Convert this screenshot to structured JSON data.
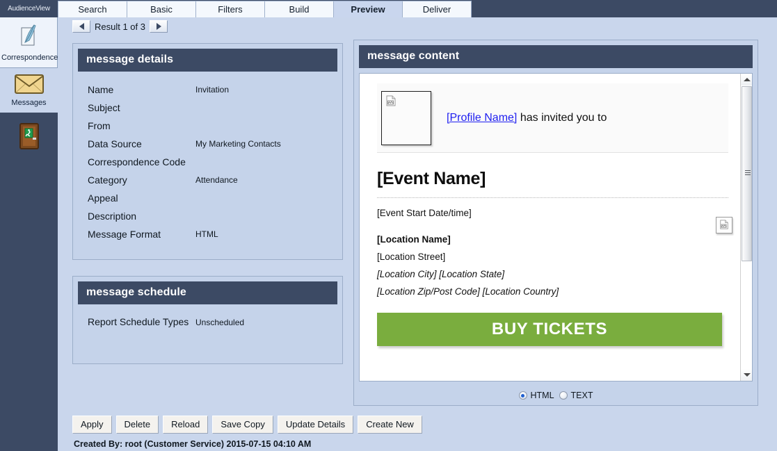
{
  "brand": {
    "name": "AudienceView"
  },
  "tabs": [
    {
      "label": "Search",
      "active": false
    },
    {
      "label": "Basic",
      "active": false
    },
    {
      "label": "Filters",
      "active": false
    },
    {
      "label": "Build",
      "active": false
    },
    {
      "label": "Preview",
      "active": true
    },
    {
      "label": "Deliver",
      "active": false
    }
  ],
  "sidebar": {
    "items": [
      {
        "label": "Correspondence",
        "icon": "quill-icon",
        "selected": true
      },
      {
        "label": "Messages",
        "icon": "envelope-icon",
        "selected": false
      },
      {
        "label": "",
        "icon": "exit-door-icon",
        "selected": false
      }
    ]
  },
  "result_nav": {
    "prev_icon": "previous-arrow-icon",
    "next_icon": "next-arrow-icon",
    "label": "Result 1 of 3"
  },
  "message_details": {
    "title": "message details",
    "fields": [
      {
        "label": "Name",
        "value": "Invitation"
      },
      {
        "label": "Subject",
        "value": ""
      },
      {
        "label": "From",
        "value": ""
      },
      {
        "label": "Data Source",
        "value": "My Marketing Contacts"
      },
      {
        "label": "Correspondence Code",
        "value": ""
      },
      {
        "label": "Category",
        "value": "Attendance"
      },
      {
        "label": "Appeal",
        "value": ""
      },
      {
        "label": "Description",
        "value": ""
      },
      {
        "label": "Message Format",
        "value": "HTML"
      }
    ]
  },
  "message_schedule": {
    "title": "message schedule",
    "fields": [
      {
        "label": "Report Schedule Types",
        "value": "Unscheduled"
      }
    ]
  },
  "message_content": {
    "title": "message content",
    "header_image_alt": "broken-image-placeholder",
    "profile_link": "[Profile Name]",
    "invite_text": " has invited you to",
    "event_name": "[Event Name]",
    "event_start": "[Event Start Date/time]",
    "location_name": "[Location Name]",
    "location_street": "[Location Street]",
    "location_city_state": "[Location City] [Location State]",
    "location_zip_country": "[Location Zip/Post Code] [Location Country]",
    "buy_button": "BUY TICKETS",
    "buy_button_color": "#7aad3e",
    "format_options": [
      {
        "label": "HTML",
        "selected": true
      },
      {
        "label": "TEXT",
        "selected": false
      }
    ]
  },
  "actions": [
    {
      "label": "Apply"
    },
    {
      "label": "Delete"
    },
    {
      "label": "Reload"
    },
    {
      "label": "Save Copy"
    },
    {
      "label": "Update Details"
    },
    {
      "label": "Create New"
    }
  ],
  "footer": {
    "created_by": "Created By: root (Customer Service) 2015-07-15 04:10 AM"
  },
  "colors": {
    "header_bar": "#3c4a64",
    "panel_bg": "#c5d3ea",
    "accent_green": "#7aad3e",
    "link_blue": "#1d1df0"
  }
}
